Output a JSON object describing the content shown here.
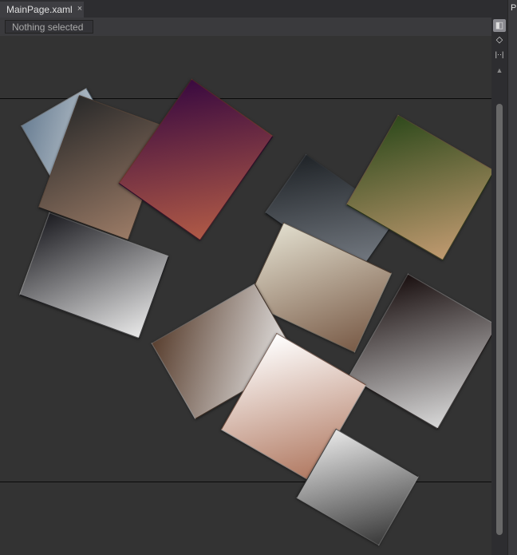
{
  "tab": {
    "label": "MainPage.xaml",
    "close": "×"
  },
  "toolbar": {
    "selection": "Nothing selected"
  },
  "side": {
    "panel_letter": "P"
  },
  "photos": [
    {
      "name": "photo-1",
      "c1": "#6a7f94",
      "c2": "#d8dde0"
    },
    {
      "name": "photo-2",
      "c1": "#2a2a2a",
      "c2": "#9b7b66"
    },
    {
      "name": "photo-3",
      "c1": "#3a0a40",
      "c2": "#b05a46"
    },
    {
      "name": "photo-4",
      "c1": "#1d1d22",
      "c2": "#e8e8e8"
    },
    {
      "name": "photo-5",
      "c1": "#202428",
      "c2": "#7a8088"
    },
    {
      "name": "photo-6",
      "c1": "#2f4a1c",
      "c2": "#c09a70"
    },
    {
      "name": "photo-7",
      "c1": "#e0dccc",
      "c2": "#7a5c48"
    },
    {
      "name": "photo-8",
      "c1": "#1a1010",
      "c2": "#d8d8d8"
    },
    {
      "name": "photo-9",
      "c1": "#5a4030",
      "c2": "#eeeeee"
    },
    {
      "name": "photo-10",
      "c1": "#ffffff",
      "c2": "#b07860"
    },
    {
      "name": "photo-11",
      "c1": "#e6e6e6",
      "c2": "#3a3a3a"
    }
  ]
}
